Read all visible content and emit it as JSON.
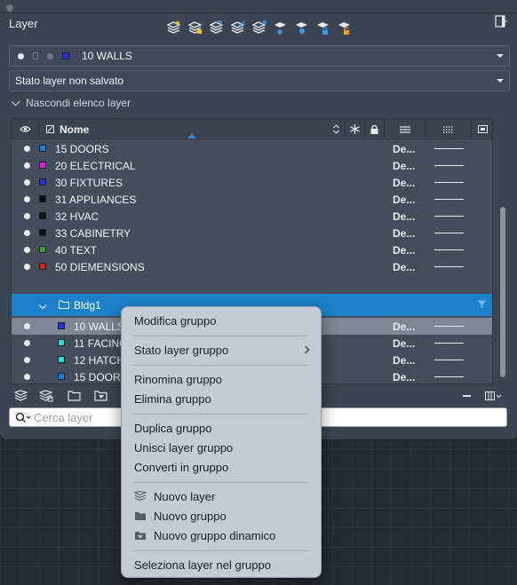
{
  "palette": {
    "title": "Layer",
    "toolbar_icons": [
      "new-layer-icon",
      "new-layer-vp-icon",
      "layer-states-icon",
      "layer-walk-icon",
      "layer-isolate-icon",
      "layer-freeze-icon",
      "layer-off-icon",
      "layer-lock-icon",
      "layer-unlock-icon"
    ]
  },
  "current_layer": {
    "name": "10 WALLS",
    "color": "#2233dd"
  },
  "layer_state": {
    "value": "Stato layer non salvato"
  },
  "toggle_list_label": "Nascondi elenco layer",
  "grid": {
    "header": {
      "name_col": "Nome"
    },
    "layers": [
      {
        "name": "15 DOORS",
        "color": "#1a7fd6",
        "linetype": "De..."
      },
      {
        "name": "20 ELECTRICAL",
        "color": "#e020e0",
        "linetype": "De..."
      },
      {
        "name": "30 FIXTURES",
        "color": "#2233dd",
        "linetype": "De..."
      },
      {
        "name": "31 APPLIANCES",
        "color": "#111111",
        "linetype": "De..."
      },
      {
        "name": "32 HVAC",
        "color": "#111111",
        "linetype": "De..."
      },
      {
        "name": "33 CABINETRY",
        "color": "#111111",
        "linetype": "De..."
      },
      {
        "name": "40 TEXT",
        "color": "#3aa02a",
        "linetype": "De..."
      },
      {
        "name": "50 DIEMENSIONS",
        "color": "#cc2211",
        "linetype": "De..."
      }
    ],
    "group": {
      "name": "Bldg1"
    },
    "group_layers": [
      {
        "name": "10 WALLS",
        "color": "#2233dd",
        "linetype": "De..."
      },
      {
        "name": "11 FACING",
        "color": "#22dddd",
        "linetype": "De..."
      },
      {
        "name": "12 HATCH",
        "color": "#22dddd",
        "linetype": "De..."
      },
      {
        "name": "15 DOORS",
        "color": "#1a7fd6",
        "linetype": "De..."
      }
    ]
  },
  "search": {
    "placeholder": "Cerca layer"
  },
  "context_menu": {
    "items": [
      {
        "label": "Modifica gruppo"
      },
      {
        "label": "Stato layer gruppo",
        "submenu": true
      },
      {
        "label": "Rinomina gruppo"
      },
      {
        "label": "Elimina gruppo"
      },
      {
        "label": "Duplica gruppo"
      },
      {
        "label": "Unisci layer gruppo"
      },
      {
        "label": "Converti in gruppo"
      },
      {
        "label": "Nuovo layer",
        "icon": "new-layer-icon"
      },
      {
        "label": "Nuovo gruppo",
        "icon": "folder-icon"
      },
      {
        "label": "Nuovo gruppo dinamico",
        "icon": "dynamic-folder-icon"
      },
      {
        "label": "Seleziona layer nel gruppo"
      }
    ]
  }
}
